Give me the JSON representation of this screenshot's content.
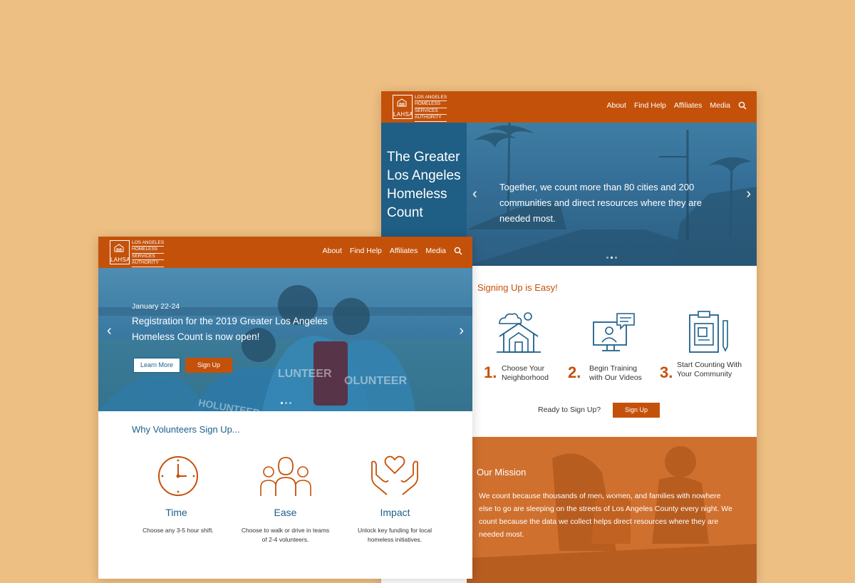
{
  "brand": {
    "logo_abbr": "LAHSA",
    "logo_lines": [
      "LOS ANGELES",
      "HOMELESS",
      "SERVICES",
      "AUTHORITY"
    ]
  },
  "nav": {
    "items": [
      "About",
      "Find Help",
      "Affiliates",
      "Media"
    ],
    "search_icon": "search-icon"
  },
  "right_page": {
    "hero_title": "The Greater Los Angeles Homeless Count",
    "hero_text": "Together, we count more than 80 cities and 200 communities and direct resources where they are needed most.",
    "signup_heading": "Signing Up is Easy!",
    "steps": [
      {
        "num": "1.",
        "label_line1": "Choose Your",
        "label_line2": "Neighborhood",
        "icon": "house-icon"
      },
      {
        "num": "2.",
        "label_line1": "Begin Training",
        "label_line2": "with Our Videos",
        "icon": "video-training-icon"
      },
      {
        "num": "3.",
        "label_line1": "Start Counting With",
        "label_line2": "Your Community",
        "icon": "clipboard-icon"
      }
    ],
    "ready_text": "Ready to Sign Up?",
    "signup_button": "Sign Up",
    "mission_heading": "Our Mission",
    "mission_text": "We count because thousands of men, women, and families with nowhere else to go are sleeping on the streets of Los Angeles County every night. We count because the data we collect helps direct resources where they are needed most."
  },
  "left_page": {
    "hero_date": "January 22-24",
    "hero_title_line1": "Registration for the 2019 Greater Los Angeles",
    "hero_title_line2": "Homeless Count is now open!",
    "learn_more": "Learn More",
    "sign_up": "Sign Up",
    "shirt_text_1": "LUNTEER",
    "shirt_text_2": "HOLUNTEER",
    "shirt_text_3": "OLUNTEER",
    "why_heading": "Why Volunteers Sign Up...",
    "reasons": [
      {
        "title": "Time",
        "desc_line1": "Choose any 3-5 hour shift.",
        "desc_line2": "",
        "icon": "clock-icon"
      },
      {
        "title": "Ease",
        "desc_line1": "Choose to walk or drive in teams",
        "desc_line2": "of 2-4 volunteers.",
        "icon": "people-group-icon"
      },
      {
        "title": "Impact",
        "desc_line1": "Unlock key funding for local",
        "desc_line2": "homeless initiatives.",
        "icon": "heart-hands-icon"
      }
    ]
  },
  "colors": {
    "background": "#eebf82",
    "brand_orange": "#c4510a",
    "brand_blue": "#1d5f8a",
    "hero_blue": "#2f6c93"
  }
}
